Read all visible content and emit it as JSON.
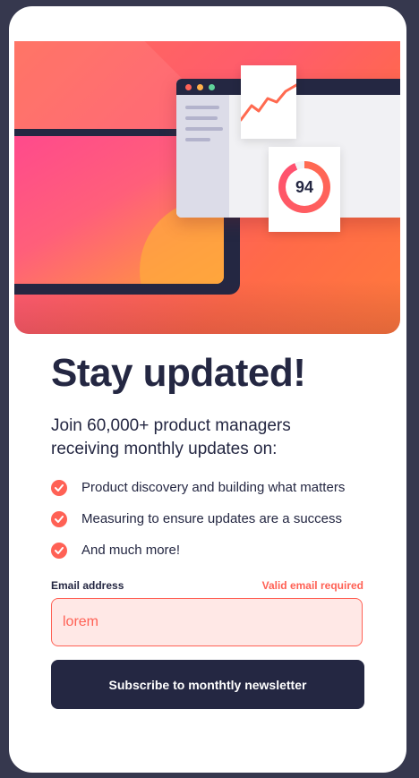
{
  "hero": {
    "score": "94",
    "colors": {
      "accent": "#ff6155",
      "dark": "#242742",
      "error_bg": "#ffe8e6"
    }
  },
  "heading": "Stay updated!",
  "intro": "Join 60,000+ product managers receiving monthly updates on:",
  "features": [
    {
      "icon": "check-icon",
      "text": "Product discovery and building what matters"
    },
    {
      "icon": "check-icon",
      "text": "Measuring to ensure updates are a success"
    },
    {
      "icon": "check-icon",
      "text": "And much more!"
    }
  ],
  "form": {
    "email_label": "Email address",
    "error_text": "Valid email required",
    "email_value": "lorem",
    "submit_label": "Subscribe to monthtly newsletter"
  }
}
